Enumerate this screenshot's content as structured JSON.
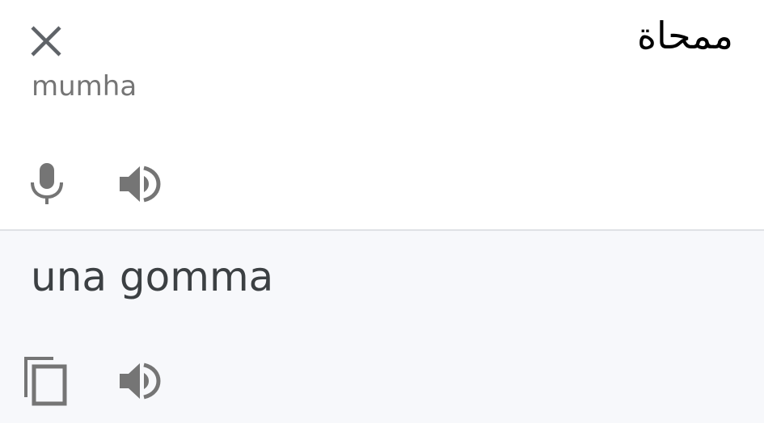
{
  "source": {
    "text": "ممحاة",
    "transliteration": "mumha"
  },
  "translation": {
    "text": "una gomma"
  },
  "icons": {
    "close": "close-icon",
    "mic": "microphone-icon",
    "speaker_source": "speaker-icon",
    "copy": "copy-icon",
    "speaker_target": "speaker-icon"
  },
  "colors": {
    "icon_gray": "#757575",
    "result_panel_bg": "#f7f8fb",
    "divider": "#dfe1e5",
    "result_text": "#3c4043",
    "source_text": "#000000"
  }
}
